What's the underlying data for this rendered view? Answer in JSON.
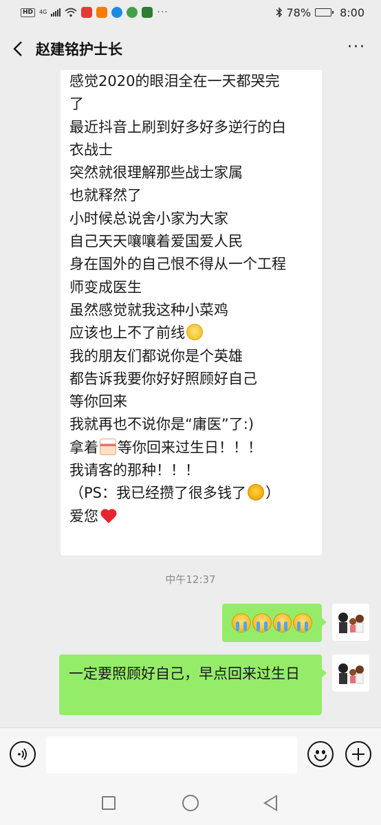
{
  "status_bar": {
    "hd_label": "HD",
    "network_label": "4G",
    "more_indicator": "···",
    "battery_percent": "78%",
    "battery_level": 0.78,
    "time": "8:00",
    "icons": [
      "hd-icon",
      "signal-icon",
      "wifi-icon",
      "app-notification-icon",
      "bluetooth-icon",
      "battery-icon"
    ]
  },
  "header": {
    "title": "赵建铭护士长",
    "back_icon": "chevron-left-icon",
    "more_icon": "more-horizontal-icon",
    "more_label": "···"
  },
  "messages": {
    "received_lines": [
      "感觉2020的眼泪全在一天都哭完",
      "了",
      "最近抖音上刷到好多好多逆行的白",
      "衣战士",
      "突然就很理解那些战士家属",
      "也就释然了",
      "小时候总说舍小家为大家",
      "自己天天嚷嚷着爱国爱人民",
      "身在国外的自己恨不得从一个工程",
      "师变成医生",
      "虽然感觉就我这种小菜鸡",
      "应该也上不了前线",
      "我的朋友们都说你是个英雄",
      "都告诉我要你好好照顾好自己",
      "等你回来",
      "我就再也不说你是“庸医”了:)",
      "拿着",
      "等你回来过生日！！！",
      "我请客的那种！！！",
      "（PS：我已经攒了很多钱了",
      "）",
      "爱您"
    ],
    "timestamp": "中午12:37",
    "sent_1_emoji_count": 4,
    "sent_1_emoji_icon": "crying-face-emoji",
    "sent_2_text": "一定要照顾好自己，早点回来过生日"
  },
  "input_bar": {
    "voice_icon": "voice-input-icon",
    "emoji_icon": "emoji-icon",
    "plus_icon": "plus-icon",
    "input_value": ""
  },
  "nav_bar": {
    "icons": [
      "recent-apps-square-icon",
      "home-circle-icon",
      "back-triangle-icon"
    ]
  },
  "colors": {
    "background": "#ededed",
    "received_bubble": "#ffffff",
    "sent_bubble": "#95ec69",
    "timestamp": "#8a8a8a"
  }
}
